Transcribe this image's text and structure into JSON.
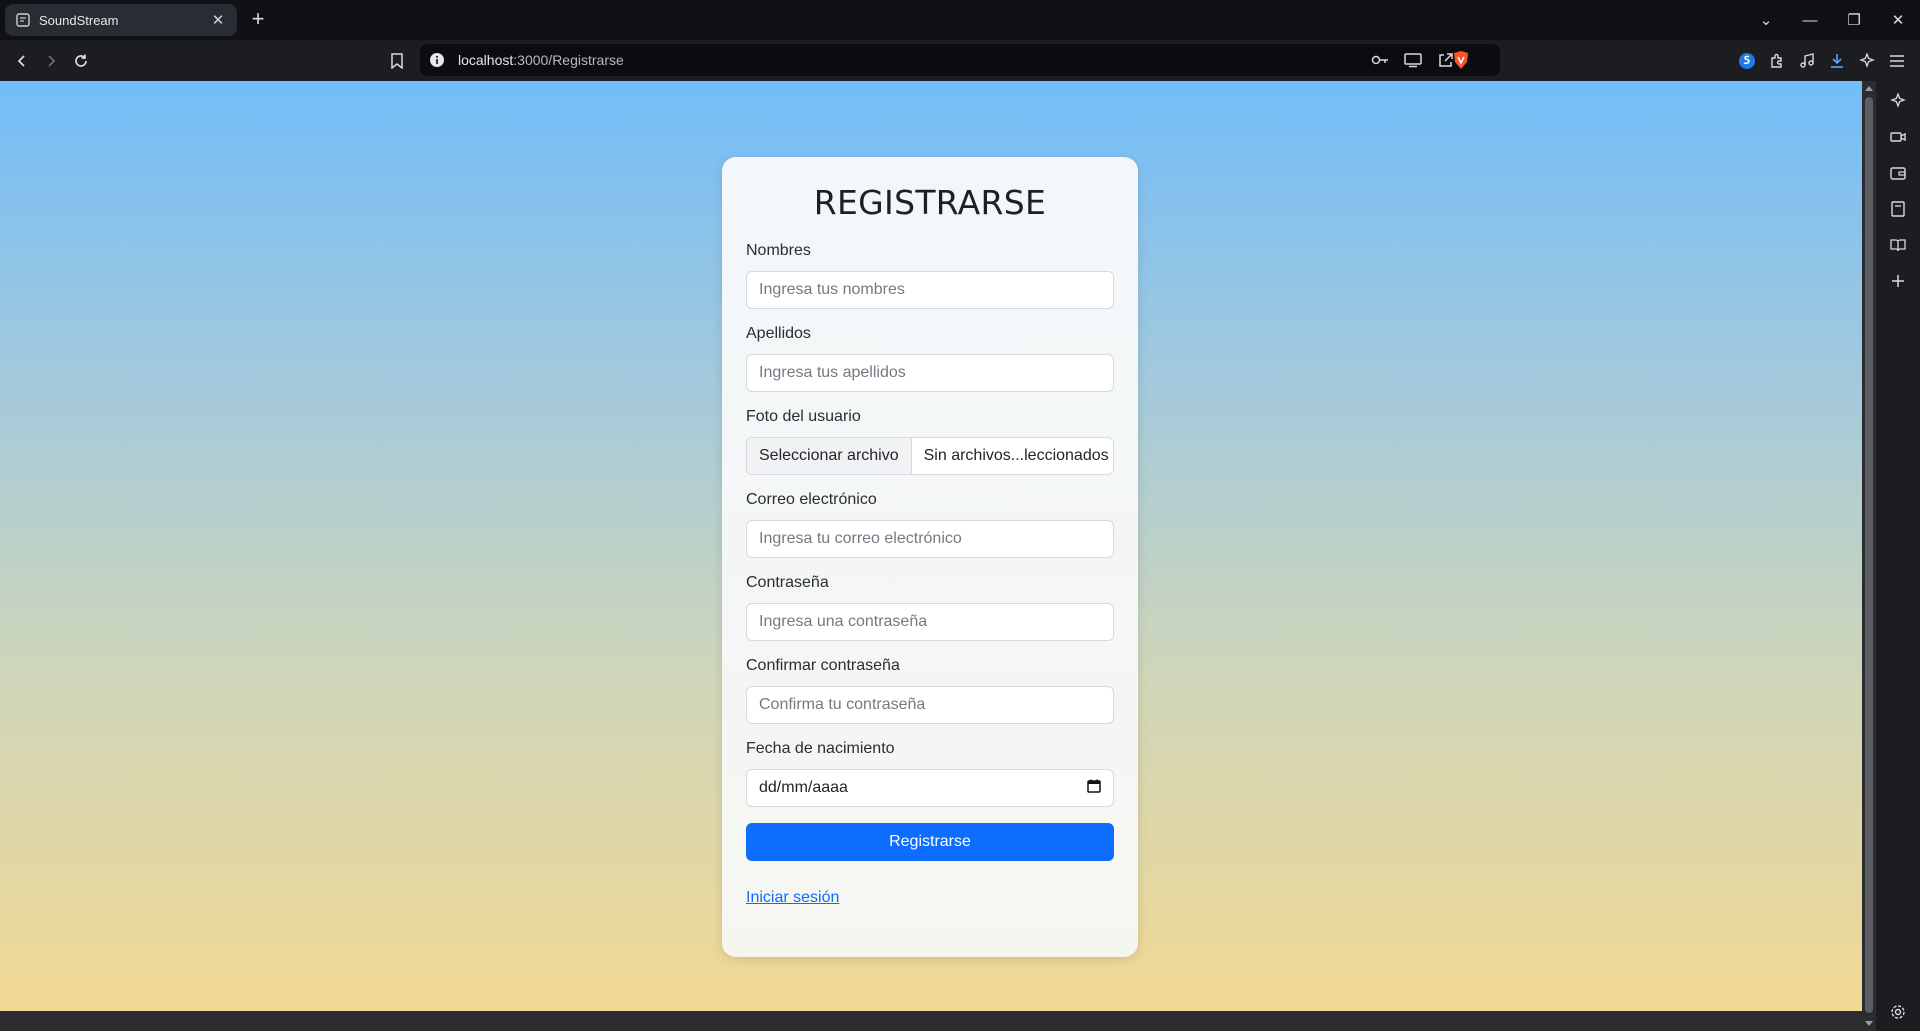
{
  "browser": {
    "tab_title": "SoundStream",
    "url_host": "localhost",
    "url_path": ":3000/Registrarse"
  },
  "form": {
    "title": "REGISTRARSE",
    "fields": [
      {
        "label": "Nombres",
        "placeholder": "Ingresa tus nombres"
      },
      {
        "label": "Apellidos",
        "placeholder": "Ingresa tus apellidos"
      },
      {
        "label": "Foto del usuario",
        "button": "Seleccionar archivo",
        "status": "Sin archivos...leccionados"
      },
      {
        "label": "Correo electrónico",
        "placeholder": "Ingresa tu correo electrónico"
      },
      {
        "label": "Contraseña",
        "placeholder": "Ingresa una contraseña"
      },
      {
        "label": "Confirmar contraseña",
        "placeholder": "Confirma tu contraseña"
      },
      {
        "label": "Fecha de nacimiento",
        "value": "dd/mm/aaaa"
      }
    ],
    "submit_label": "Registrarse",
    "login_link": "Iniciar sesión"
  },
  "colors": {
    "accent": "#0d6efd",
    "gradient_top": "#72bdf8",
    "gradient_bottom": "#f1d893"
  }
}
